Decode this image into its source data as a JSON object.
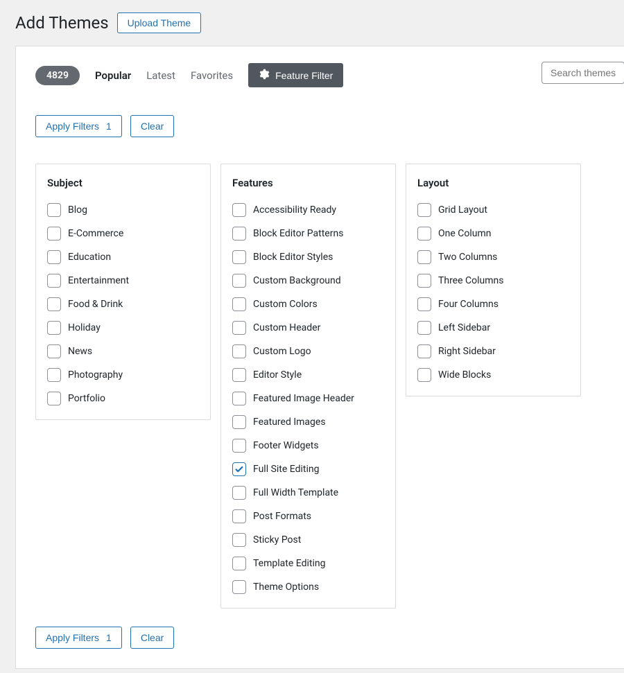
{
  "header": {
    "title": "Add Themes",
    "upload_label": "Upload Theme"
  },
  "filterbar": {
    "count": "4829",
    "nav": {
      "popular": "Popular",
      "latest": "Latest",
      "favorites": "Favorites"
    },
    "feature_filter_label": "Feature Filter"
  },
  "search": {
    "placeholder": "Search themes..."
  },
  "buttons": {
    "apply_label": "Apply Filters",
    "apply_count": "1",
    "clear_label": "Clear"
  },
  "filters": {
    "subject": {
      "title": "Subject",
      "items": [
        {
          "label": "Blog",
          "checked": false
        },
        {
          "label": "E-Commerce",
          "checked": false
        },
        {
          "label": "Education",
          "checked": false
        },
        {
          "label": "Entertainment",
          "checked": false
        },
        {
          "label": "Food & Drink",
          "checked": false
        },
        {
          "label": "Holiday",
          "checked": false
        },
        {
          "label": "News",
          "checked": false
        },
        {
          "label": "Photography",
          "checked": false
        },
        {
          "label": "Portfolio",
          "checked": false
        }
      ]
    },
    "features": {
      "title": "Features",
      "items": [
        {
          "label": "Accessibility Ready",
          "checked": false
        },
        {
          "label": "Block Editor Patterns",
          "checked": false
        },
        {
          "label": "Block Editor Styles",
          "checked": false
        },
        {
          "label": "Custom Background",
          "checked": false
        },
        {
          "label": "Custom Colors",
          "checked": false
        },
        {
          "label": "Custom Header",
          "checked": false
        },
        {
          "label": "Custom Logo",
          "checked": false
        },
        {
          "label": "Editor Style",
          "checked": false
        },
        {
          "label": "Featured Image Header",
          "checked": false
        },
        {
          "label": "Featured Images",
          "checked": false
        },
        {
          "label": "Footer Widgets",
          "checked": false
        },
        {
          "label": "Full Site Editing",
          "checked": true
        },
        {
          "label": "Full Width Template",
          "checked": false
        },
        {
          "label": "Post Formats",
          "checked": false
        },
        {
          "label": "Sticky Post",
          "checked": false
        },
        {
          "label": "Template Editing",
          "checked": false
        },
        {
          "label": "Theme Options",
          "checked": false
        }
      ]
    },
    "layout": {
      "title": "Layout",
      "items": [
        {
          "label": "Grid Layout",
          "checked": false
        },
        {
          "label": "One Column",
          "checked": false
        },
        {
          "label": "Two Columns",
          "checked": false
        },
        {
          "label": "Three Columns",
          "checked": false
        },
        {
          "label": "Four Columns",
          "checked": false
        },
        {
          "label": "Left Sidebar",
          "checked": false
        },
        {
          "label": "Right Sidebar",
          "checked": false
        },
        {
          "label": "Wide Blocks",
          "checked": false
        }
      ]
    }
  }
}
